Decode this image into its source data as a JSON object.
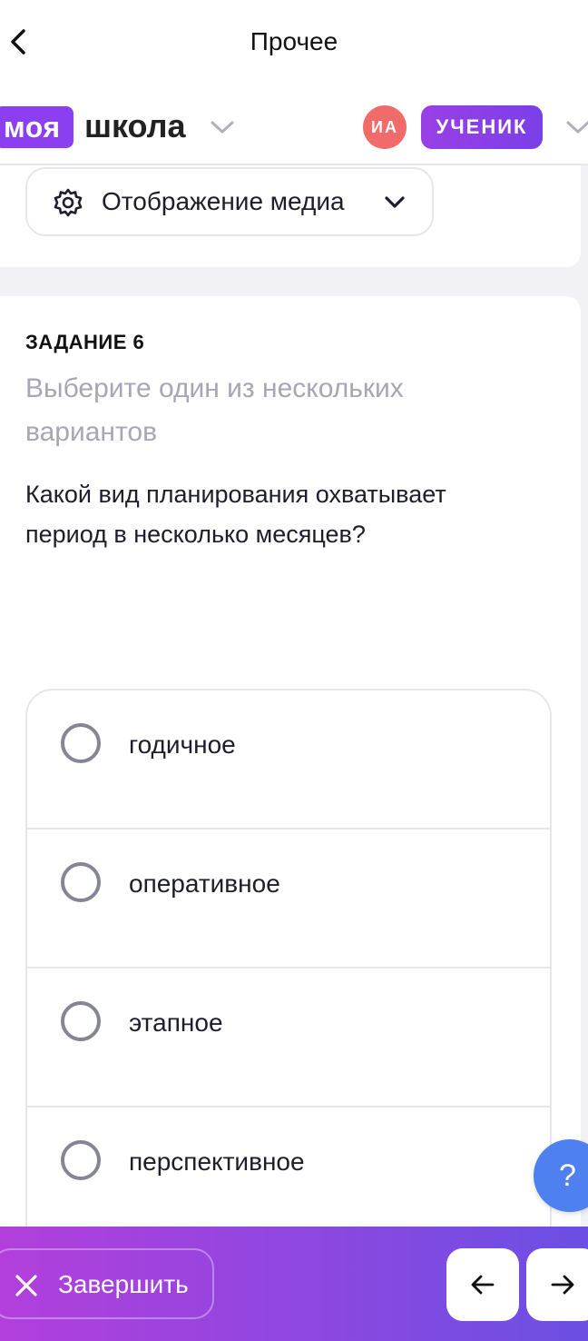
{
  "topbar": {
    "title": "Прочее"
  },
  "header": {
    "logo_part1": "моя",
    "logo_part2": "школа",
    "avatar_initials": "ИА",
    "role": "УЧЕНИК"
  },
  "media": {
    "label": "Отображение медиа"
  },
  "task": {
    "number": "ЗАДАНИЕ 6",
    "hint": "Выберите один из нескольких вариантов",
    "question": "Какой вид планирования охватывает период в несколько месяцев?",
    "options": [
      {
        "label": "годичное",
        "selected": false
      },
      {
        "label": "оперативное",
        "selected": false
      },
      {
        "label": "этапное",
        "selected": false
      },
      {
        "label": "перспективное",
        "selected": false
      }
    ]
  },
  "help": {
    "label": "?"
  },
  "bottom": {
    "finish_label": "Завершить"
  },
  "colors": {
    "brand_purple": "#8b3ff0",
    "avatar_red": "#f26b6b",
    "help_blue": "#4f80f0",
    "hint_gray": "#a6a6b6"
  }
}
